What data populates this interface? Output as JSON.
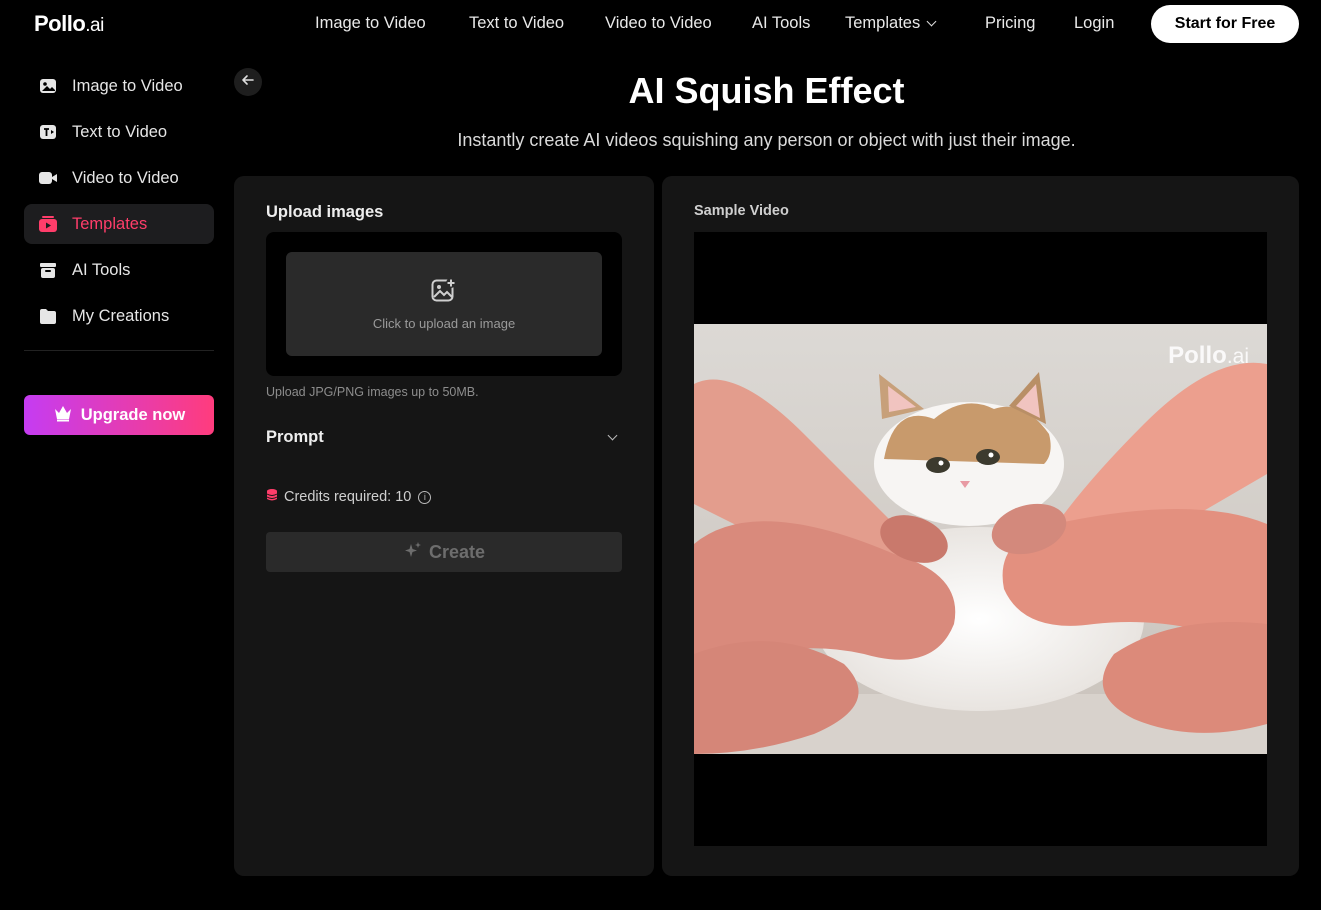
{
  "brand": {
    "logo_main": "Pollo",
    "logo_suffix": ".ai"
  },
  "nav": {
    "links": [
      "Image to Video",
      "Text to Video",
      "Video to Video",
      "AI Tools",
      "Templates",
      "Pricing",
      "Login"
    ],
    "cta": "Start for Free"
  },
  "sidebar": {
    "items": [
      {
        "label": "Image to Video",
        "icon": "image-video-icon",
        "active": false
      },
      {
        "label": "Text to Video",
        "icon": "text-video-icon",
        "active": false
      },
      {
        "label": "Video to Video",
        "icon": "video-camera-icon",
        "active": false
      },
      {
        "label": "Templates",
        "icon": "templates-icon",
        "active": true
      },
      {
        "label": "AI Tools",
        "icon": "toolbox-icon",
        "active": false
      },
      {
        "label": "My Creations",
        "icon": "folder-icon",
        "active": false
      }
    ],
    "upgrade_label": "Upgrade now"
  },
  "page": {
    "title": "AI Squish Effect",
    "subtitle": "Instantly create AI videos squishing any person or object with just their image."
  },
  "left_panel": {
    "upload_heading": "Upload images",
    "upload_prompt": "Click to upload an image",
    "upload_hint": "Upload JPG/PNG images up to 50MB.",
    "prompt_heading": "Prompt",
    "credits_text": "Credits required: 10",
    "create_label": "Create"
  },
  "right_panel": {
    "heading": "Sample Video",
    "watermark_main": "Pollo",
    "watermark_suffix": ".ai"
  },
  "colors": {
    "accent": "#ff3d6a",
    "upgrade_gradient_start": "#c53cf2",
    "upgrade_gradient_end": "#ff3c7d"
  }
}
